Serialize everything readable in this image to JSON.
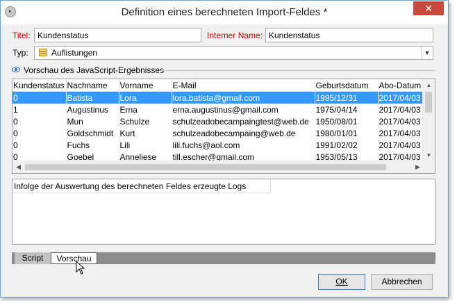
{
  "window": {
    "title": "Definition eines berechneten Import-Feldes *",
    "app_icon": "dialog-app-icon",
    "close_label": "✕"
  },
  "form": {
    "titel_label": "Titel:",
    "titel_value": "Kundenstatus",
    "internal_name_label": "Interner Name:",
    "internal_name_value": "Kundenstatus",
    "typ_label": "Typ:",
    "typ_value": "Auflistungen"
  },
  "preview": {
    "section_label": "Vorschau des JavaScript-Ergebnisses",
    "columns": [
      "Kundenstatus",
      "Nachname",
      "Vorname",
      "E-Mail",
      "Geburtsdatum",
      "Abo-Datum"
    ],
    "rows": [
      [
        "0",
        "Batista",
        "Lora",
        "lora.batista@gmail.com",
        "1995/12/31",
        "2017/04/03"
      ],
      [
        "1",
        "Augustinus",
        "Erna",
        "erna.augustinus@gmail.com",
        "1975/04/14",
        "2017/04/03"
      ],
      [
        "0",
        "Mun",
        "Schulze",
        "schulzeadobecampaingtest@web.de",
        "1950/08/01",
        "2017/04/03"
      ],
      [
        "0",
        "Goldschmidt",
        "Kurt",
        "schulzeadobecampaing@web.de",
        "1980/01/01",
        "2017/04/03"
      ],
      [
        "0",
        "Fuchs",
        "Lili",
        "lili.fuchs@aol.com",
        "1991/02/02",
        "2017/04/03"
      ],
      [
        "0",
        "Goebel",
        "Anneliese",
        "till.escher@gmail.com",
        "1953/05/13",
        "2017/04/03"
      ]
    ],
    "selected_row": 0
  },
  "logs": {
    "header": "Infolge der Auswertung des berechneten Feldes erzeugte Logs"
  },
  "tabs": [
    {
      "label": "Script",
      "active": false
    },
    {
      "label": "Vorschau",
      "active": true
    }
  ],
  "buttons": {
    "ok_label": "OK",
    "cancel_label": "Abbrechen"
  },
  "colors": {
    "selection": "#3399ff",
    "required_label": "#c00000",
    "close_button": "#c9483c"
  }
}
